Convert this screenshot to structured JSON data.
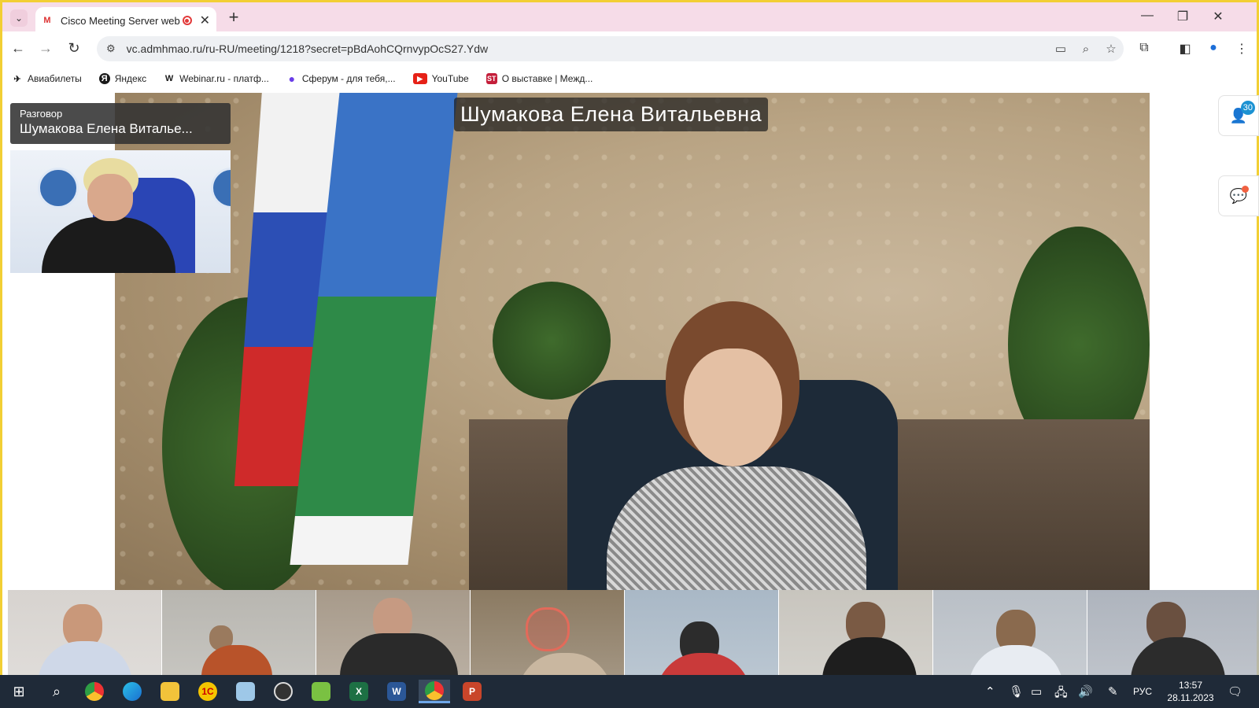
{
  "browser": {
    "tab_title": "Cisco Meeting Server web a",
    "tab_favicon": "M",
    "url": "vc.admhmao.ru/ru-RU/meeting/1218?secret=pBdAohCQrnvypOcS27.Ydw",
    "new_tab_label": "+",
    "window_controls": {
      "minimize": "—",
      "restore": "❐",
      "close": "✕"
    },
    "frame_color": "#f2cf34",
    "tabbar_color": "#f6dce8"
  },
  "bookmarks": [
    {
      "label": "Авиабилеты",
      "icon": "plane-icon",
      "glyph": "✈",
      "color": "#1a1a1a"
    },
    {
      "label": "Яндекс",
      "icon": "yandex-icon",
      "glyph": "Я",
      "color": "#1a1a1a"
    },
    {
      "label": "Webinar.ru - платф...",
      "icon": "webinar-icon",
      "glyph": "W",
      "color": "#1a1a1a"
    },
    {
      "label": "Сферум - для тебя,...",
      "icon": "sferum-icon",
      "glyph": "●",
      "color": "#6a3de8"
    },
    {
      "label": "YouTube",
      "icon": "youtube-icon",
      "glyph": "▶",
      "color": "#e62117"
    },
    {
      "label": "О выставке | Межд...",
      "icon": "expo-icon",
      "glyph": "ST",
      "color": "#c41e3a"
    }
  ],
  "meeting": {
    "main_speaker_name": "Шумакова Елена Витальевна",
    "speaker_card_label": "Разговор",
    "speaker_card_name": "Шумакова Елена Виталье...",
    "participants_count": "30",
    "participants_icon": "participants-icon",
    "chat_icon": "chat-icon"
  },
  "filmstrip": [
    {
      "bg": "#d7d3cf",
      "head": "#c9987a",
      "body": "#cfd8e8"
    },
    {
      "bg": "#b8b6b0",
      "head": "#9a7a5e",
      "body": "#b8532a"
    },
    {
      "bg": "#a79a8a",
      "head": "#c69a82",
      "body": "#2a2a2a"
    },
    {
      "bg": "#8b7a62",
      "head": "#d25a4a",
      "body": "#c9b7a0"
    },
    {
      "bg": "#a9b8c6",
      "head": "#2c2c2c",
      "body": "#c93a3a"
    },
    {
      "bg": "#c8c5be",
      "head": "#7a5a44",
      "body": "#1e1e1e"
    },
    {
      "bg": "#b9bfc6",
      "head": "#8a6a4e",
      "body": "#e8ecf2"
    },
    {
      "bg": "#aeb4bd",
      "head": "#6a5040",
      "body": "#2c2c2c"
    }
  ],
  "taskbar": {
    "apps": [
      "start-icon",
      "search-icon",
      "chrome-icon",
      "edge-icon",
      "explorer-icon",
      "1c-icon",
      "notes-icon",
      "capture-icon",
      "viewer-icon",
      "excel-icon",
      "word-icon",
      "chrome-active-icon",
      "powerpoint-icon"
    ],
    "language": "РУС",
    "time": "13:57",
    "date": "28.11.2023"
  }
}
